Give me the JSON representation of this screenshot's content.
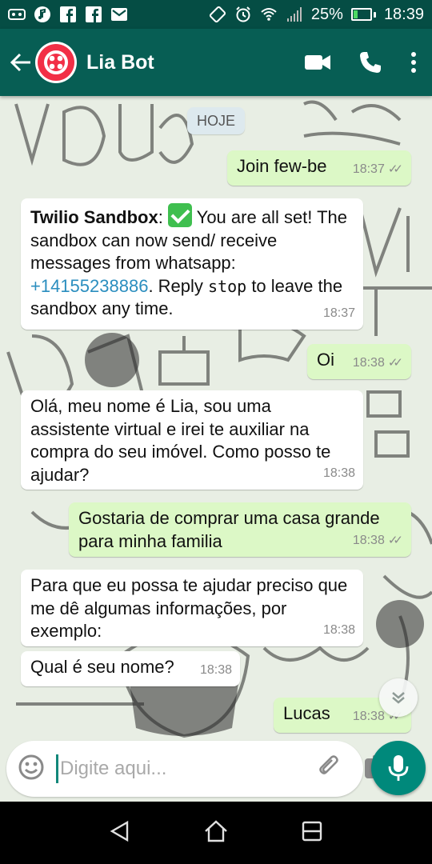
{
  "status_bar": {
    "battery_percent": "25%",
    "time": "18:39",
    "battery_level": 0.25
  },
  "header": {
    "title": "Lia Bot",
    "back_icon": "arrow-left-icon",
    "video_icon": "video-camera-icon",
    "call_icon": "phone-icon",
    "menu_icon": "more-vert-icon"
  },
  "chat": {
    "date_label": "HOJE",
    "messages": [
      {
        "dir": "out",
        "text": "Join few-be",
        "time": "18:37"
      },
      {
        "dir": "in",
        "sender": "Twilio Sandbox",
        "text_a": ": ",
        "text_b": " You are all set! The sandbox can now send/ receive messages from whatsapp: ",
        "phone": "+14155238886",
        "text_c": ". Reply ",
        "keyword": "stop",
        "text_d": " to leave the sandbox any time.",
        "time": "18:37"
      },
      {
        "dir": "out",
        "text": "Oi",
        "time": "18:38"
      },
      {
        "dir": "in",
        "text": "Olá, meu nome é Lia, sou uma assistente virtual e irei te auxiliar na compra do seu imóvel. Como posso te ajudar?",
        "time": "18:38"
      },
      {
        "dir": "out",
        "text": "Gostaria de comprar uma casa grande para minha familia",
        "time": "18:38"
      },
      {
        "dir": "in",
        "text": "Para que eu possa te ajudar preciso que me dê algumas informações, por exemplo:",
        "time": "18:38"
      },
      {
        "dir": "in",
        "text": "Qual é seu nome?",
        "time": "18:38"
      },
      {
        "dir": "out",
        "text": "Lucas",
        "time": "18:38"
      }
    ]
  },
  "composer": {
    "placeholder": "Digite aqui...",
    "emoji_icon": "emoji-icon",
    "attach_icon": "paperclip-icon",
    "camera_icon": "camera-icon",
    "mic_icon": "microphone-icon"
  },
  "colors": {
    "header": "#075e54",
    "status_bar": "#054d44",
    "outgoing_bubble": "#dcf8c6",
    "incoming_bubble": "#ffffff",
    "accent": "#00897b"
  }
}
